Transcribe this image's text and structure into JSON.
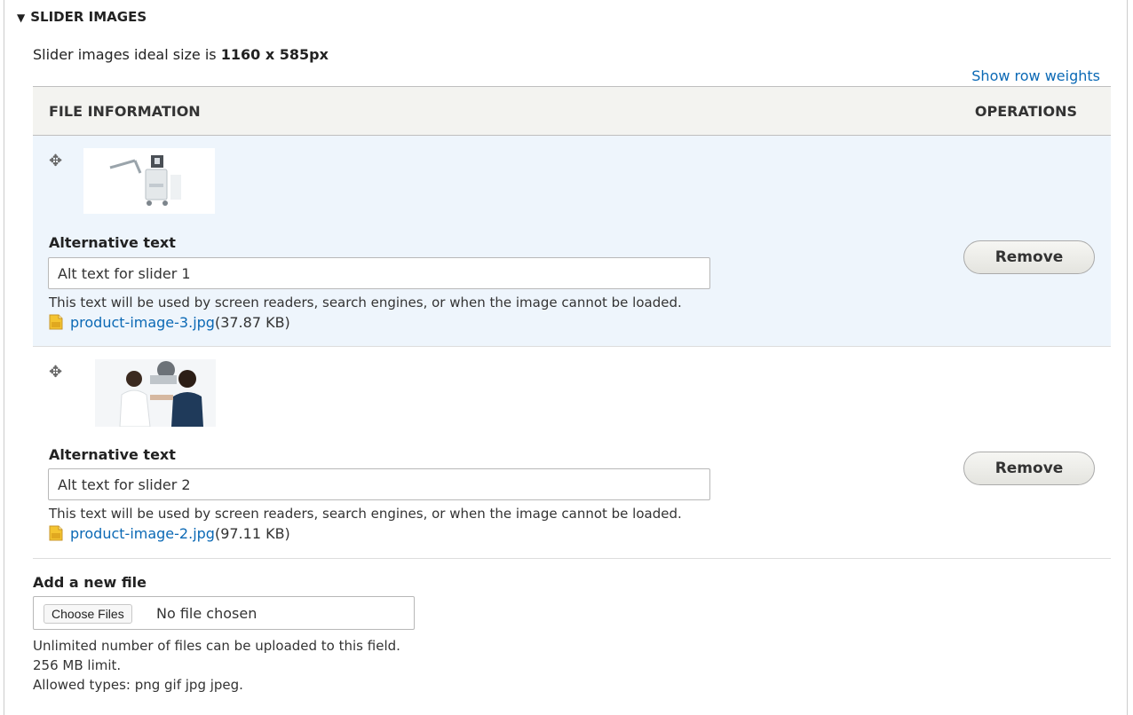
{
  "fieldset": {
    "legend": "SLIDER IMAGES",
    "toggle_glyph": "▼",
    "description_prefix": "Slider images ideal size is ",
    "description_size": "1160 x 585px",
    "show_row_weights": "Show row weights"
  },
  "table": {
    "col_file_info": "FILE INFORMATION",
    "col_operations": "OPERATIONS",
    "rows": [
      {
        "alt_label": "Alternative text",
        "alt_value": "Alt text for slider 1",
        "help": "This text will be used by screen readers, search engines, or when the image cannot be loaded.",
        "file_name": "product-image-3.jpg",
        "file_size": "(37.87 KB)",
        "remove_label": "Remove"
      },
      {
        "alt_label": "Alternative text",
        "alt_value": "Alt text for slider 2",
        "help": "This text will be used by screen readers, search engines, or when the image cannot be loaded.",
        "file_name": "product-image-2.jpg",
        "file_size": "(97.11 KB)",
        "remove_label": "Remove"
      }
    ]
  },
  "upload": {
    "label": "Add a new file",
    "choose_button": "Choose Files",
    "no_file": "No file chosen",
    "rule_count": "Unlimited number of files can be uploaded to this field.",
    "rule_size": "256 MB limit.",
    "rule_types": "Allowed types: png gif jpg jpeg."
  },
  "icons": {
    "drag_handle": "drag-handle-icon",
    "file_type": "image-file-icon",
    "toggle": "triangle-down-icon"
  },
  "colors": {
    "link": "#0b69b5",
    "row_highlight": "#eef5fc",
    "header_bg": "#f3f3f0"
  }
}
